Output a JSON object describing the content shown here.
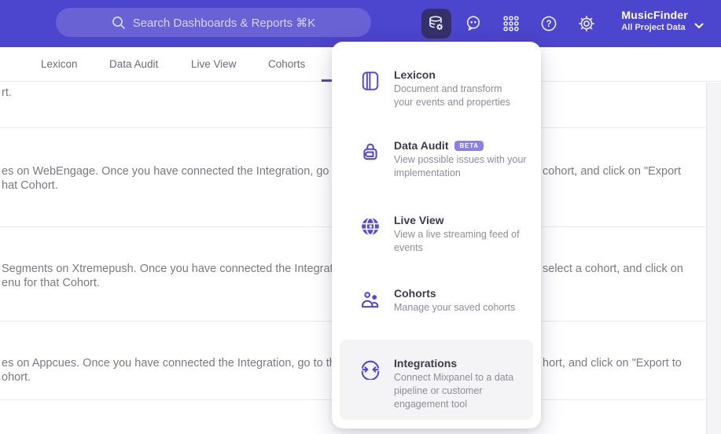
{
  "header": {
    "search": {
      "placeholder": "Search Dashboards & Reports ⌘K"
    },
    "project": {
      "name": "MusicFinder",
      "scope": "All Project Data"
    }
  },
  "tabs": [
    {
      "label": "Lexicon"
    },
    {
      "label": "Data Audit"
    },
    {
      "label": "Live View"
    },
    {
      "label": "Cohorts"
    }
  ],
  "menu": {
    "items": [
      {
        "title": "Lexicon",
        "lines": [
          "Document and transform",
          "your events and properties"
        ]
      },
      {
        "title": "Data Audit",
        "badge": "BETA",
        "lines": [
          "View possible issues with your",
          "implementation"
        ]
      },
      {
        "title": "Live View",
        "lines": [
          "View a live streaming feed of",
          "events"
        ]
      },
      {
        "title": "Cohorts",
        "lines": [
          "Manage your saved cohorts"
        ]
      },
      {
        "title": "Integrations",
        "highlighted": true,
        "lines": [
          "Connect Mixpanel to a data",
          "pipeline or customer",
          "engagement tool"
        ]
      }
    ]
  },
  "background": {
    "rows": [
      {
        "line1_left": "rt."
      },
      {
        "line1_left": "es on WebEngage. Once you have connected the Integration, go to the",
        "line1_right": "cohort, and click on \"Export",
        "line2": "hat Cohort."
      },
      {
        "line1_left": "Segments on Xtremepush. Once you have connected the Integration,",
        "line1_right": "select a cohort, and click on",
        "line2": "enu for that Cohort."
      },
      {
        "line1_left": "es on Appcues. Once you have connected the Integration, go to the M",
        "line1_right": "hort, and click on \"Export to",
        "line2": "ohort."
      }
    ]
  },
  "colors": {
    "header_purple": "#4c45cd",
    "accent_purple": "#5448d9",
    "badge_purple": "#8b80e8",
    "highlight_gray": "#f4f4f6",
    "text_dark": "#3f3a4c",
    "text_gray": "#8f8c99"
  }
}
